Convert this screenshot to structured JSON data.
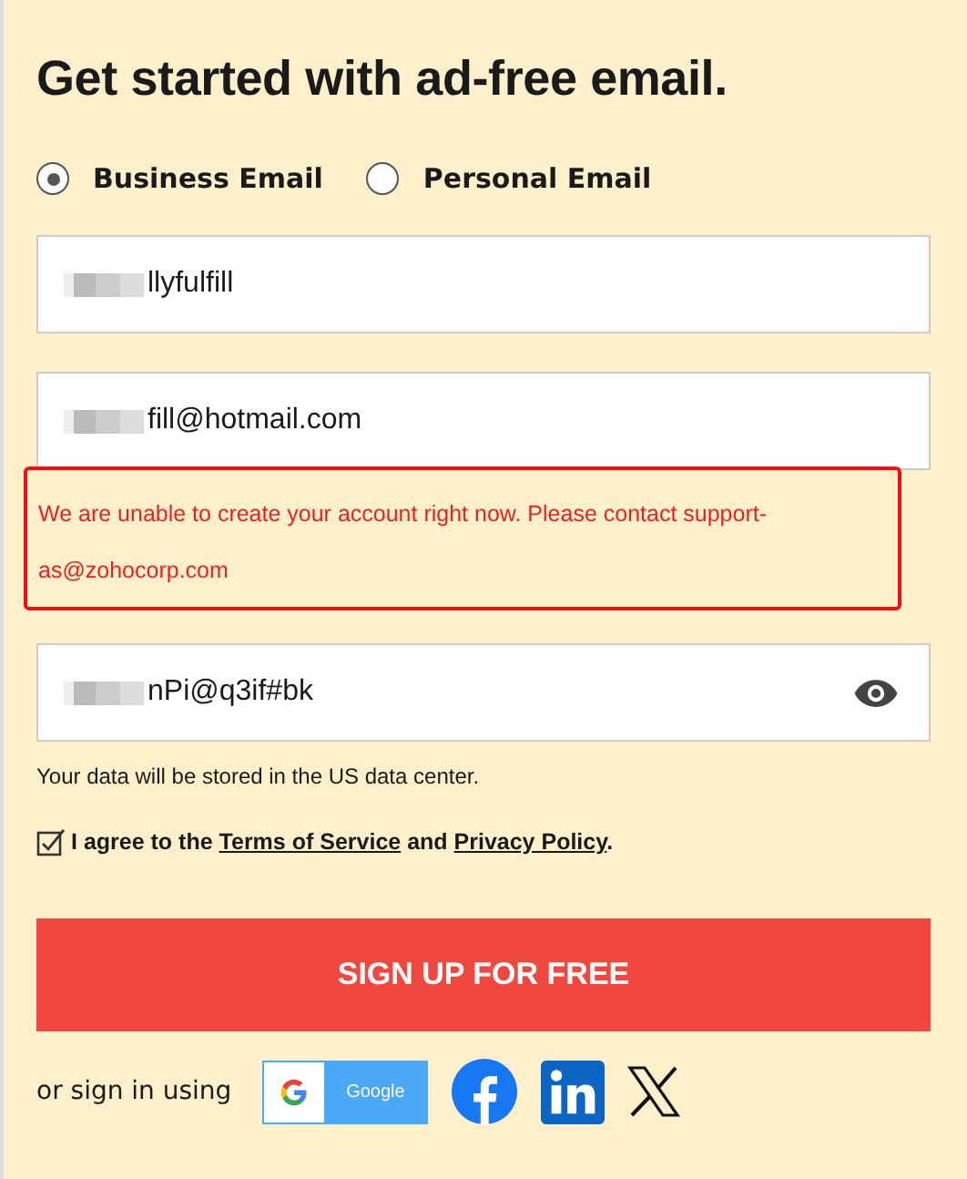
{
  "title": "Get started with ad-free email.",
  "account_types": [
    {
      "label": "Business Email",
      "selected": true
    },
    {
      "label": "Personal Email",
      "selected": false
    }
  ],
  "fields": [
    {
      "kind": "text",
      "value": "llyfulfill",
      "redacted": true
    },
    {
      "kind": "text",
      "value": "fill@hotmail.com",
      "redacted": true
    },
    {
      "kind": "password",
      "value": "nPi@q3if#bk",
      "redacted": true
    }
  ],
  "error": "We are unable to create your account right now. Please contact support-as@zohocorp.com",
  "data_center_note": "Your data will be stored in the US data center.",
  "agreement": {
    "checked": true,
    "prefix": "I agree to the",
    "terms": "Terms of Service",
    "middle": "and",
    "privacy": "Privacy Policy",
    "suffix": "."
  },
  "submit": "SIGN UP FOR FREE",
  "social": {
    "label": "or sign in using",
    "google": "Google"
  }
}
